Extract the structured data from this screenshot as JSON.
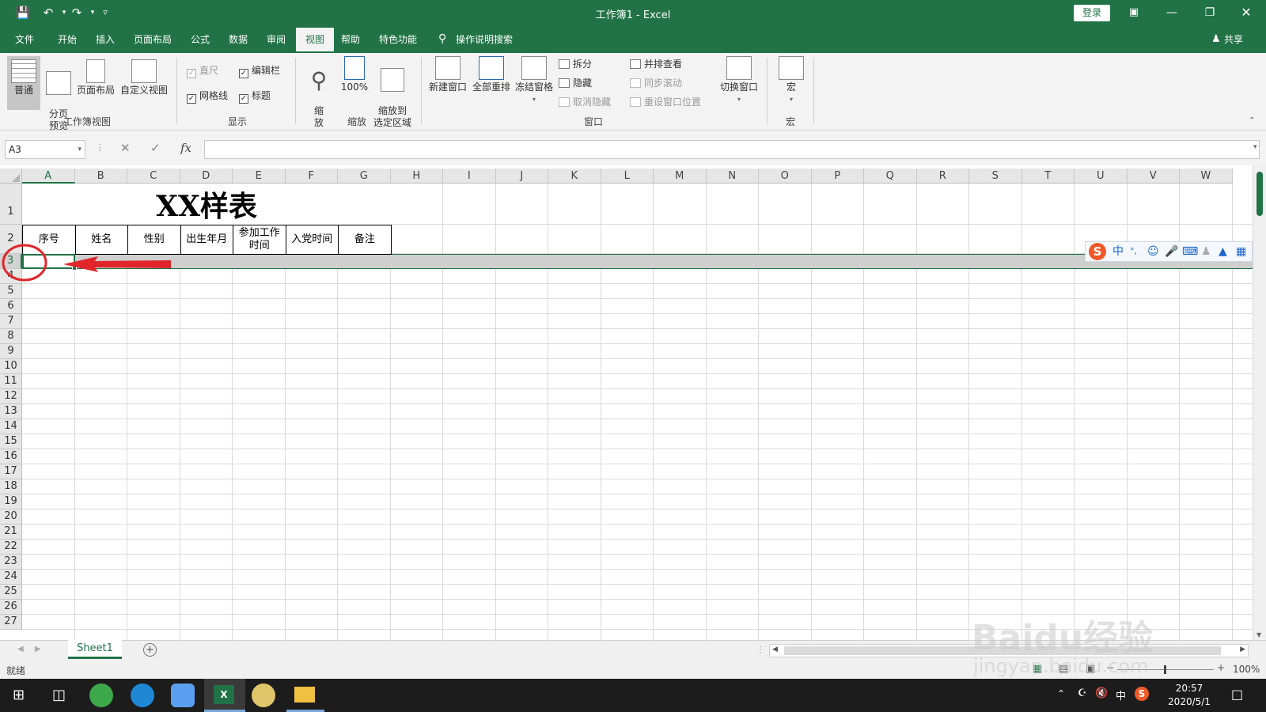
{
  "window": {
    "title": "工作簿1  -  Excel",
    "login": "登录",
    "share": "共享"
  },
  "tabs": [
    "文件",
    "开始",
    "插入",
    "页面布局",
    "公式",
    "数据",
    "审阅",
    "视图",
    "帮助",
    "特色功能"
  ],
  "active_tab": "视图",
  "tell_me": "操作说明搜索",
  "ribbon": {
    "workbook_views": {
      "group": "工作簿视图",
      "normal": "普通",
      "page_break": "分页\n预览",
      "page_layout": "页面布局",
      "custom": "自定义视图"
    },
    "show": {
      "group": "显示",
      "ruler": "直尺",
      "formula_bar": "编辑栏",
      "gridlines": "网格线",
      "headings": "标题"
    },
    "zoom": {
      "group": "缩放",
      "zoom": "缩\n放",
      "hundred": "100%",
      "to_selection": "缩放到\n选定区域"
    },
    "window": {
      "group": "窗口",
      "new_window": "新建窗口",
      "arrange_all": "全部重排",
      "freeze": "冻结窗格",
      "split": "拆分",
      "hide": "隐藏",
      "unhide": "取消隐藏",
      "side_by_side": "并排查看",
      "sync_scroll": "同步滚动",
      "reset_pos": "重设窗口位置",
      "switch": "切换窗口"
    },
    "macros": {
      "group": "宏",
      "macros": "宏"
    }
  },
  "formula_bar": {
    "name_box": "A3",
    "fx": "fx",
    "value": ""
  },
  "columns": [
    "A",
    "B",
    "C",
    "D",
    "E",
    "F",
    "G",
    "H",
    "I",
    "J",
    "K",
    "L",
    "M",
    "N",
    "O",
    "P",
    "Q",
    "R",
    "S",
    "T",
    "U",
    "V",
    "W"
  ],
  "rows": [
    "1",
    "2",
    "3",
    "4",
    "5",
    "6",
    "7",
    "8",
    "9",
    "10",
    "11",
    "12",
    "13",
    "14",
    "15",
    "16",
    "17",
    "18",
    "19",
    "20",
    "21",
    "22",
    "23",
    "24",
    "25",
    "26",
    "27"
  ],
  "sheet": {
    "title": "XX样表",
    "headers": [
      "序号",
      "姓名",
      "性别",
      "出生年月",
      "参加工作\n时间",
      "入党时间",
      "备注"
    ]
  },
  "ime_toolbar": {
    "lang": "中",
    "punct": "°,"
  },
  "sheet_tabs": [
    "Sheet1"
  ],
  "status": {
    "ready": "就绪",
    "zoom": "100%"
  },
  "taskbar": {
    "time": "20:57",
    "date": "2020/5/1",
    "ime": "中"
  },
  "watermark": {
    "line1": "Baidu经验",
    "line2": "jingyan.baidu.com"
  },
  "colors": {
    "excel_green": "#217346",
    "annotation_red": "#e0262b"
  }
}
